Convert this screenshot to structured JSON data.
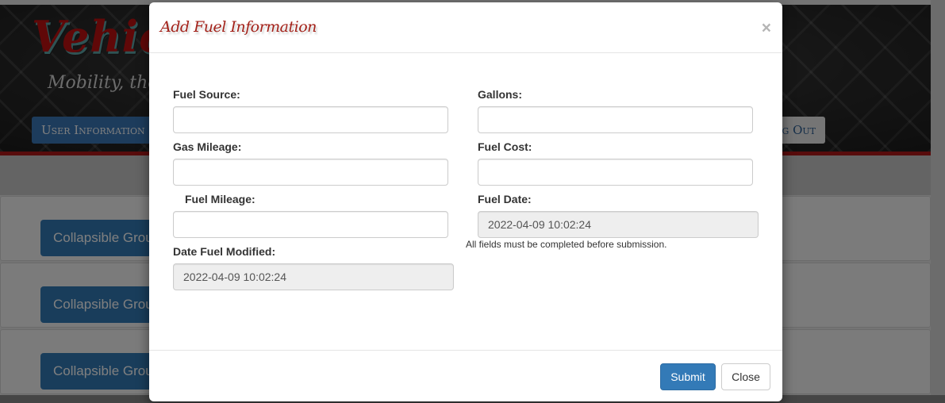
{
  "background_page": {
    "header": {
      "logo_text": "Vehicle",
      "tagline": "Mobility, the",
      "buttons": {
        "user_information": "User Information",
        "log_out": "g Out"
      }
    },
    "panels": [
      {
        "button_label": "Collapsible Group"
      },
      {
        "button_label": "Collapsible Group"
      },
      {
        "button_label": "Collapsible Group"
      }
    ]
  },
  "modal": {
    "title": "Add Fuel Information",
    "close_icon": "×",
    "fields": {
      "fuel_source": {
        "label": "Fuel Source:",
        "value": ""
      },
      "gallons": {
        "label": "Gallons:",
        "value": ""
      },
      "gas_mileage": {
        "label": "Gas Mileage:",
        "value": ""
      },
      "fuel_cost": {
        "label": "Fuel Cost:",
        "value": ""
      },
      "fuel_mileage": {
        "label": "Fuel Mileage:",
        "value": ""
      },
      "fuel_date": {
        "label": "Fuel Date:",
        "value": "2022-04-09 10:02:24",
        "readonly": true
      },
      "date_fuel_modified": {
        "label": "Date Fuel Modified:",
        "value": "2022-04-09 10:02:24",
        "readonly": true
      }
    },
    "help_text": "All fields must be completed before submission.",
    "footer": {
      "submit_label": "Submit",
      "close_label": "Close"
    }
  },
  "colors": {
    "primary": "#337ab7",
    "title_red": "#a3221a",
    "banner_stripe": "#b01818"
  }
}
